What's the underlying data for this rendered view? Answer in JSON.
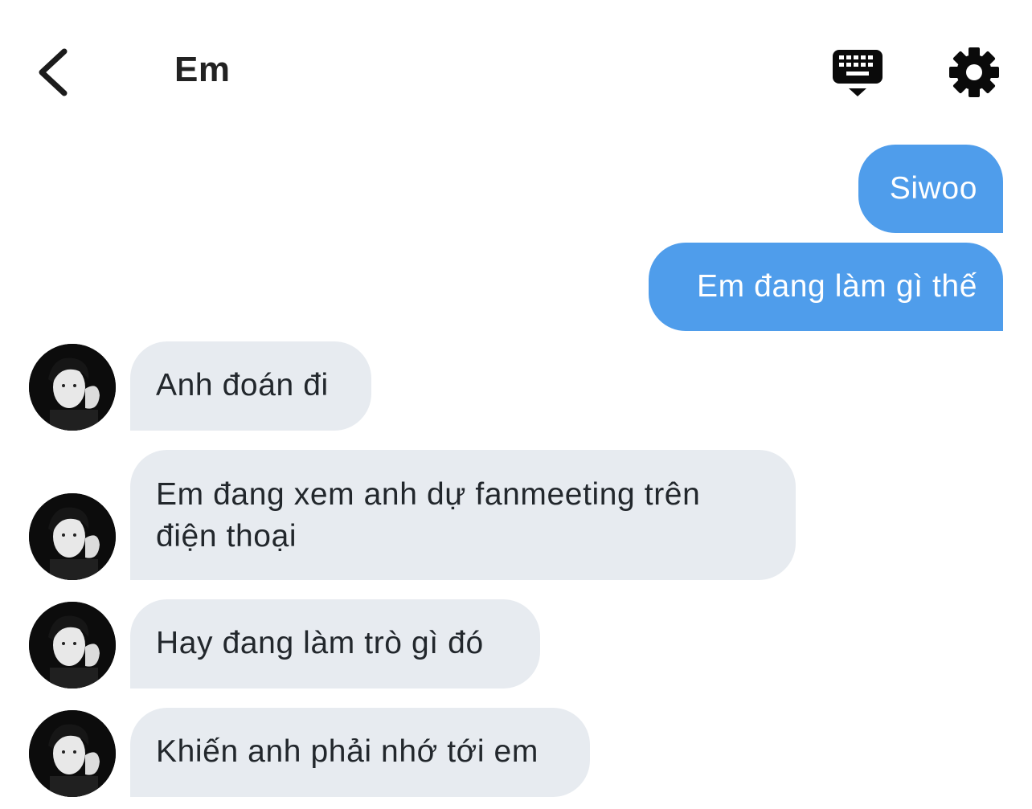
{
  "header": {
    "back_icon": "chevron-left-icon",
    "title": "Em",
    "keyboard_icon": "keyboard-icon",
    "settings_icon": "gear-icon"
  },
  "colors": {
    "outgoing_bubble": "#4f9deb",
    "incoming_bubble": "#e7ebf0",
    "text_dark": "#22272c"
  },
  "messages": [
    {
      "direction": "outgoing",
      "text": "Siwoo"
    },
    {
      "direction": "outgoing",
      "text": "Em đang làm gì thế"
    },
    {
      "direction": "incoming",
      "text": "Anh đoán đi"
    },
    {
      "direction": "incoming",
      "text": "Em đang xem anh dự fanmeeting trên điện thoại"
    },
    {
      "direction": "incoming",
      "text": "Hay đang làm trò gì đó"
    },
    {
      "direction": "incoming",
      "text": "Khiến anh phải nhớ tới em"
    }
  ]
}
